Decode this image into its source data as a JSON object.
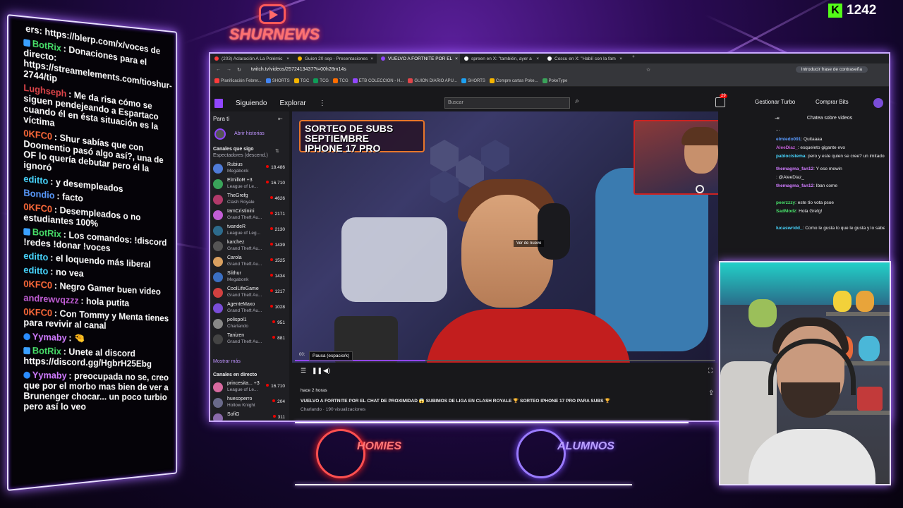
{
  "overlay": {
    "brand": "SHURNEWS",
    "kick_count": "1242",
    "kick_icon": "K",
    "homies_label": "HOMIES",
    "alumnos_label": "ALUMNOS"
  },
  "chat": [
    {
      "user": "",
      "text": "ers: https://blerp.com/x/voces de",
      "color": "#ffffff",
      "badge": "none"
    },
    {
      "user": "BotRix",
      "text": ": Donaciones para el directo: https://streamelements.com/tioshur-2744/tip",
      "color": "#48e06a",
      "badge": "bot"
    },
    {
      "user": "Lughseph",
      "text": ": Me da risa cómo se siguen pendejeando a Espartaco cuando él en ésta situación es la víctima",
      "color": "#e0454a",
      "badge": "none"
    },
    {
      "user": "0KFC0",
      "text": ": Shur sabías que con Doomentio pasó algo así?, una de OF lo quería debutar pero él la ignoró",
      "color": "#ff6a3a",
      "badge": "none"
    },
    {
      "user": "editto",
      "text": ": y desempleados",
      "color": "#48d6ff",
      "badge": "none"
    },
    {
      "user": "Bondio",
      "text": ": facto",
      "color": "#5a9bff",
      "badge": "none"
    },
    {
      "user": "0KFC0",
      "text": ": Desempleados o no estudiantes 100%",
      "color": "#ff6a3a",
      "badge": "none"
    },
    {
      "user": "BotRix",
      "text": ": Los comandos: !discord !redes !donar !voces",
      "color": "#48e06a",
      "badge": "bot"
    },
    {
      "user": "editto",
      "text": ": el loquendo más liberal",
      "color": "#48d6ff",
      "badge": "none"
    },
    {
      "user": "editto",
      "text": ": no vea",
      "color": "#48d6ff",
      "badge": "none"
    },
    {
      "user": "0KFC0",
      "text": ": Negro Gamer buen video",
      "color": "#ff6a3a",
      "badge": "none"
    },
    {
      "user": "andrewvqzzz",
      "text": ": hola putita",
      "color": "#c25ed6",
      "badge": "none"
    },
    {
      "user": "0KFC0",
      "text": ": Con Tommy y Menta tienes para revivir al canal",
      "color": "#ff6a3a",
      "badge": "none"
    },
    {
      "user": "Yymaby",
      "text": ": 🤏",
      "color": "#d07bff",
      "badge": "verified"
    },
    {
      "user": "BotRix",
      "text": ": Unete al discord https://discord.gg/HgbrH25Ebg",
      "color": "#48e06a",
      "badge": "bot"
    },
    {
      "user": "Yymaby",
      "text": ": preocupada no se, creo que por el morbo mas bien de ver a Brunenger chocar... un poco turbio pero así lo veo",
      "color": "#d07bff",
      "badge": "verified"
    }
  ],
  "browser": {
    "tabs": [
      {
        "label": "(203) Aclaración A La Polémic",
        "active": false,
        "icon_color": "#ff3b3b"
      },
      {
        "label": "Guion 20 sep - Presentaciones",
        "active": false,
        "icon_color": "#f4b400"
      },
      {
        "label": "VUELVO A FORTNITE POR EL",
        "active": true,
        "icon_color": "#9146ff"
      },
      {
        "label": "spreen en X: \"también, ayer a",
        "active": false,
        "icon_color": "#ffffff"
      },
      {
        "label": "Coscu en X: \"Habíí con la fam",
        "active": false,
        "icon_color": "#ffffff"
      }
    ],
    "url": "twitch.tv/videos/2572413437?t=00h28m14s",
    "password_button": "Introducir frase de contraseña",
    "bookmarks": [
      "Planificación Febrer...",
      "SHORTS",
      "TGC",
      "TCG",
      "TCG",
      "ETB COLECCION - H...",
      "GUION DIARIO APU...",
      "SHORTS",
      "Compre cartas Poke...",
      "PokeType"
    ]
  },
  "twitch": {
    "nav": {
      "following": "Siguiendo",
      "browse": "Explorar",
      "search_placeholder": "Buscar",
      "turbo": "Gestionar Turbo",
      "bits": "Comprar Bits",
      "notif_count": "29"
    },
    "sidebar": {
      "header": "Para ti",
      "stories": "Abrir historias",
      "followed_title": "Canales que sigo",
      "followed_sub": "Espectadores (descend.)",
      "channels": [
        {
          "name": "Rubius",
          "game": "Megabonk",
          "viewers": "18.486",
          "color": "#4f7bd8"
        },
        {
          "name": "ElmilloR +3",
          "game": "League of Le...",
          "viewers": "16.710",
          "color": "#3aa35a"
        },
        {
          "name": "TheGrefg",
          "game": "Clash Royale",
          "viewers": "4626",
          "color": "#b23a6a"
        },
        {
          "name": "IamCristinini",
          "game": "Grand Theft Au...",
          "viewers": "2171",
          "color": "#c25ed6"
        },
        {
          "name": "tvandeR",
          "game": "League of Leg...",
          "viewers": "2130",
          "color": "#2d6b8c"
        },
        {
          "name": "karchez",
          "game": "Grand Theft Au...",
          "viewers": "1439",
          "color": "#555555"
        },
        {
          "name": "Carola",
          "game": "Grand Theft Au...",
          "viewers": "1525",
          "color": "#d9a060"
        },
        {
          "name": "Slithur",
          "game": "Megabonk",
          "viewers": "1434",
          "color": "#3b6fc2"
        },
        {
          "name": "CoolLifeGame",
          "game": "Grand Theft Au...",
          "viewers": "1217",
          "color": "#d14040"
        },
        {
          "name": "AgenteMaxo",
          "game": "Grand Theft Au...",
          "viewers": "1028",
          "color": "#7a4dd8"
        },
        {
          "name": "polispol1",
          "game": "Charlando",
          "viewers": "951",
          "color": "#888888"
        },
        {
          "name": "Tanizen",
          "game": "Grand Theft Au...",
          "viewers": "881",
          "color": "#444444"
        }
      ],
      "show_more": "Mostrar más",
      "live_title": "Canales en directo",
      "live": [
        {
          "name": "princesita... +3",
          "game": "League of Le...",
          "viewers": "16.710",
          "color": "#d86aa0"
        },
        {
          "name": "huesoperro",
          "game": "Hollow Knight",
          "viewers": "204",
          "color": "#6a6a8a"
        },
        {
          "name": "SofiG",
          "game": "",
          "viewers": "311",
          "color": "#8a6aaa"
        }
      ]
    },
    "video": {
      "sorteo_line1": "SORTEO DE SUBS",
      "sorteo_line2": "SEPTIEMBRE",
      "sorteo_line3": "IPHONE 17 PRO",
      "watch_again": "Ver de nuevo",
      "pause_tip": "Pausa (espacio/k)",
      "timecode": "00:",
      "progress_fraction": 0.31,
      "posted": "hace 2 horas",
      "title": "VUELVO A FORTNITE POR EL CHAT DE PROXIMIDAD 😱 SUBIMOS DE LIGA EN CLASH ROYALE 🏆 SORTEO IPHONE 17 PRO PARA SUBS 🏆",
      "meta": "Charlando · 190 visualizaciones"
    },
    "chat": {
      "title": "Chatea sobre videos",
      "lines": [
        {
          "user": "",
          "text": "...",
          "color": "#efeff1"
        },
        {
          "user": "elmiedo091",
          "text": ": Quitaaaa",
          "color": "#5a9bff"
        },
        {
          "user": "AleeDiaz_",
          "text": ": esqueleto gigante evo",
          "color": "#c25ed6"
        },
        {
          "user": "pablocistema",
          "text": ": pero y este quien se cree? un imitador de ibai, seguro",
          "color": "#48d6ff"
        },
        {
          "user": "themagma_fan12",
          "text": ": Y ese mewin",
          "color": "#d07bff"
        },
        {
          "user": "",
          "text": ": @AleeDiaz_",
          "color": "#efeff1"
        },
        {
          "user": "themagma_fan12",
          "text": ": Iban come",
          "color": "#d07bff"
        },
        {
          "user": "",
          "text": "",
          "color": "#e0454a"
        },
        {
          "user": "peerzzzy",
          "text": ": este tío vota psoe",
          "color": "#48e06a"
        },
        {
          "user": "SadModz",
          "text": ": Hola Grefg!",
          "color": "#48e06a"
        },
        {
          "user": "",
          "text": "",
          "color": "#e0454a"
        },
        {
          "user": "lucaswridd_",
          "text": ": Como le gusta lo que le gusta y lo sabe",
          "color": "#48d6ff"
        }
      ]
    }
  },
  "colors": {
    "twitch_purple": "#9146ff",
    "neon_purple": "#a86bff",
    "neon_red": "#ff3b3b",
    "kick_green": "#53fc18"
  }
}
